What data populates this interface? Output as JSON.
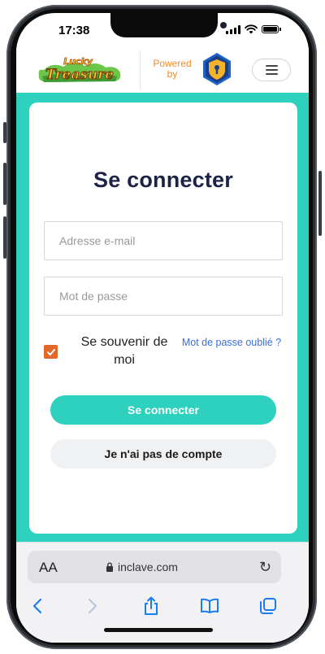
{
  "status_bar": {
    "time": "17:38"
  },
  "header": {
    "logo_text": [
      "Lucky",
      "Treasure"
    ],
    "powered_by": [
      "Powered",
      "by"
    ]
  },
  "login": {
    "title": "Se connecter",
    "email_placeholder": "Adresse e-mail",
    "password_placeholder": "Mot de passe",
    "remember_label": "Se souvenir de moi",
    "remember_checked": true,
    "forgot_link": "Mot de passe oublié ?",
    "submit_label": "Se connecter",
    "no_account_label": "Je n'ai pas de compte"
  },
  "browser": {
    "aa_label": "AA",
    "url": "inclave.com"
  },
  "colors": {
    "accent_teal": "#2ed1bd",
    "title_navy": "#1c2347",
    "checkbox_orange": "#e4682a",
    "link_blue": "#3b6fd6",
    "powered_orange": "#f08a2a",
    "ios_blue": "#1a7cf5"
  }
}
